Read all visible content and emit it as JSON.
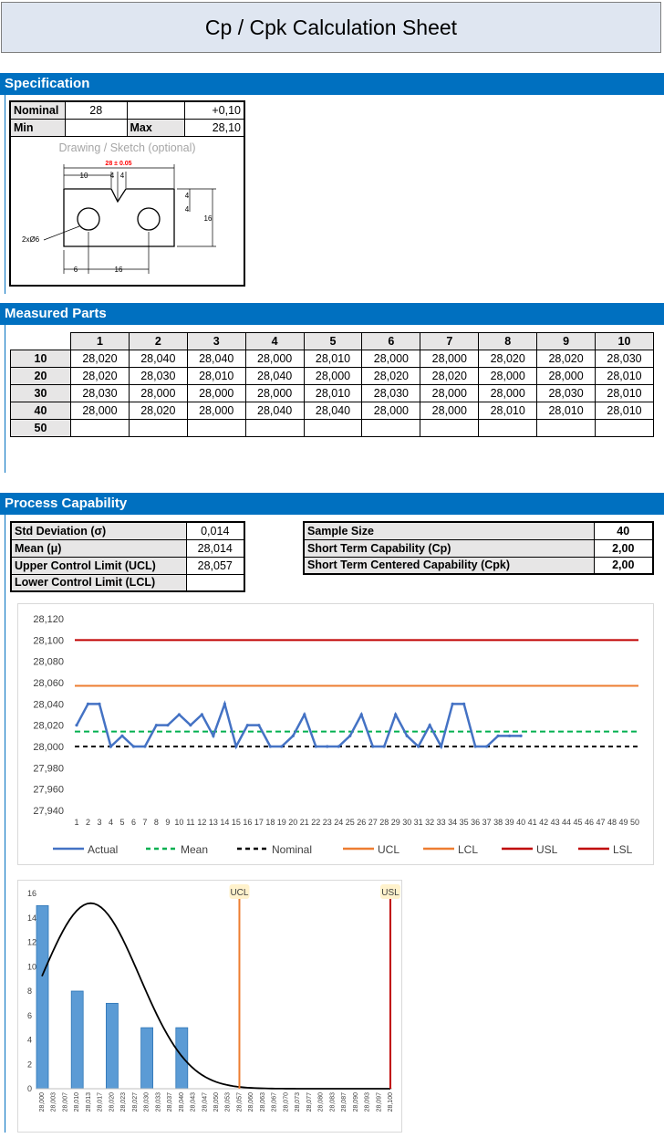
{
  "title": "Cp / Cpk Calculation Sheet",
  "specification": {
    "header": "Specification",
    "nominal_label": "Nominal",
    "nominal_value": "28",
    "tolerance": "+0,10",
    "min_label": "Min",
    "max_label": "Max",
    "max_value": "28,10",
    "drawing_label": "Drawing / Sketch (optional)",
    "sketch": {
      "dim_main": "28 ± 0.05",
      "dim_10": "10",
      "dim_4a": "4",
      "dim_4b": "4",
      "dim_4c": "4",
      "dim_4d": "4",
      "dim_16_height": "16",
      "dim_6": "6",
      "dim_16_bottom": "16",
      "hole_label": "2xØ6"
    }
  },
  "measured": {
    "header": "Measured Parts",
    "columns": [
      "1",
      "2",
      "3",
      "4",
      "5",
      "6",
      "7",
      "8",
      "9",
      "10"
    ],
    "rows": [
      {
        "label": "10",
        "values": [
          "28,020",
          "28,040",
          "28,040",
          "28,000",
          "28,010",
          "28,000",
          "28,000",
          "28,020",
          "28,020",
          "28,030"
        ]
      },
      {
        "label": "20",
        "values": [
          "28,020",
          "28,030",
          "28,010",
          "28,040",
          "28,000",
          "28,020",
          "28,020",
          "28,000",
          "28,000",
          "28,010"
        ]
      },
      {
        "label": "30",
        "values": [
          "28,030",
          "28,000",
          "28,000",
          "28,000",
          "28,010",
          "28,030",
          "28,000",
          "28,000",
          "28,030",
          "28,010"
        ]
      },
      {
        "label": "40",
        "values": [
          "28,000",
          "28,020",
          "28,000",
          "28,040",
          "28,040",
          "28,000",
          "28,000",
          "28,010",
          "28,010",
          "28,010"
        ]
      },
      {
        "label": "50",
        "values": [
          "",
          "",
          "",
          "",
          "",
          "",
          "",
          "",
          "",
          ""
        ]
      }
    ]
  },
  "capability": {
    "header": "Process Capability",
    "left": [
      {
        "label": "Std Deviation (σ)",
        "value": "0,014"
      },
      {
        "label": "Mean (μ)",
        "value": "28,014"
      },
      {
        "label": "Upper Control Limit (UCL)",
        "value": "28,057"
      },
      {
        "label": "Lower Control Limit (LCL)",
        "value": ""
      }
    ],
    "right": [
      {
        "label": "Sample Size",
        "value": "40"
      },
      {
        "label": "Short Term Capability (Cp)",
        "value": "2,00"
      },
      {
        "label": "Short Term Centered Capability (Cpk)",
        "value": "2,00"
      }
    ]
  },
  "colors": {
    "accent": "#0070c0",
    "actual": "#4472c4",
    "mean": "#00b050",
    "ucl": "#ed7d31",
    "usl": "#c00000",
    "bar": "#5b9bd5"
  },
  "chart_data": [
    {
      "type": "line",
      "y_ticks": [
        "28,120",
        "28,100",
        "28,080",
        "28,060",
        "28,040",
        "28,020",
        "28,000",
        "27,980",
        "27,960",
        "27,940"
      ],
      "ylim": [
        27.94,
        28.12
      ],
      "x_ticks": [
        "1",
        "2",
        "3",
        "4",
        "5",
        "6",
        "7",
        "8",
        "9",
        "10",
        "11",
        "12",
        "13",
        "14",
        "15",
        "16",
        "17",
        "18",
        "19",
        "20",
        "21",
        "22",
        "23",
        "24",
        "25",
        "26",
        "27",
        "28",
        "29",
        "30",
        "31",
        "32",
        "33",
        "34",
        "35",
        "36",
        "37",
        "38",
        "39",
        "40",
        "41",
        "42",
        "43",
        "44",
        "45",
        "46",
        "47",
        "48",
        "49",
        "50"
      ],
      "legend": [
        "Actual",
        "Mean",
        "Nominal",
        "UCL",
        "LCL",
        "USL",
        "LSL"
      ],
      "legend_position": "bottom",
      "series": [
        {
          "name": "Actual",
          "values": [
            28.02,
            28.04,
            28.04,
            28.0,
            28.01,
            28.0,
            28.0,
            28.02,
            28.02,
            28.03,
            28.02,
            28.03,
            28.01,
            28.04,
            28.0,
            28.02,
            28.02,
            28.0,
            28.0,
            28.01,
            28.03,
            28.0,
            28.0,
            28.0,
            28.01,
            28.03,
            28.0,
            28.0,
            28.03,
            28.01,
            28.0,
            28.02,
            28.0,
            28.04,
            28.04,
            28.0,
            28.0,
            28.01,
            28.01,
            28.01
          ]
        },
        {
          "name": "Mean",
          "value": 28.014
        },
        {
          "name": "Nominal",
          "value": 28.0
        },
        {
          "name": "UCL",
          "value": 28.057
        },
        {
          "name": "USL",
          "value": 28.1
        }
      ]
    },
    {
      "type": "bar",
      "y_ticks": [
        "16",
        "14",
        "12",
        "10",
        "8",
        "6",
        "4",
        "2",
        "0"
      ],
      "ylim": [
        0,
        16
      ],
      "categories": [
        "28,000",
        "28,003",
        "28,007",
        "28,010",
        "28,013",
        "28,017",
        "28,020",
        "28,023",
        "28,027",
        "28,030",
        "28,033",
        "28,037",
        "28,040",
        "28,043",
        "28,047",
        "28,050",
        "28,053",
        "28,057",
        "28,060",
        "28,063",
        "28,067",
        "28,070",
        "28,073",
        "28,077",
        "28,080",
        "28,083",
        "28,087",
        "28,090",
        "28,093",
        "28,097",
        "28,100"
      ],
      "values": [
        15,
        0,
        0,
        8,
        0,
        0,
        7,
        0,
        0,
        5,
        0,
        0,
        5,
        0,
        0,
        0,
        0,
        0,
        0,
        0,
        0,
        0,
        0,
        0,
        0,
        0,
        0,
        0,
        0,
        0,
        0
      ],
      "markers": [
        {
          "label": "UCL",
          "at": "28,057"
        },
        {
          "label": "USL",
          "at": "28,100"
        }
      ],
      "curve": "normal distribution (mean 28,014, σ 0,014)"
    }
  ]
}
